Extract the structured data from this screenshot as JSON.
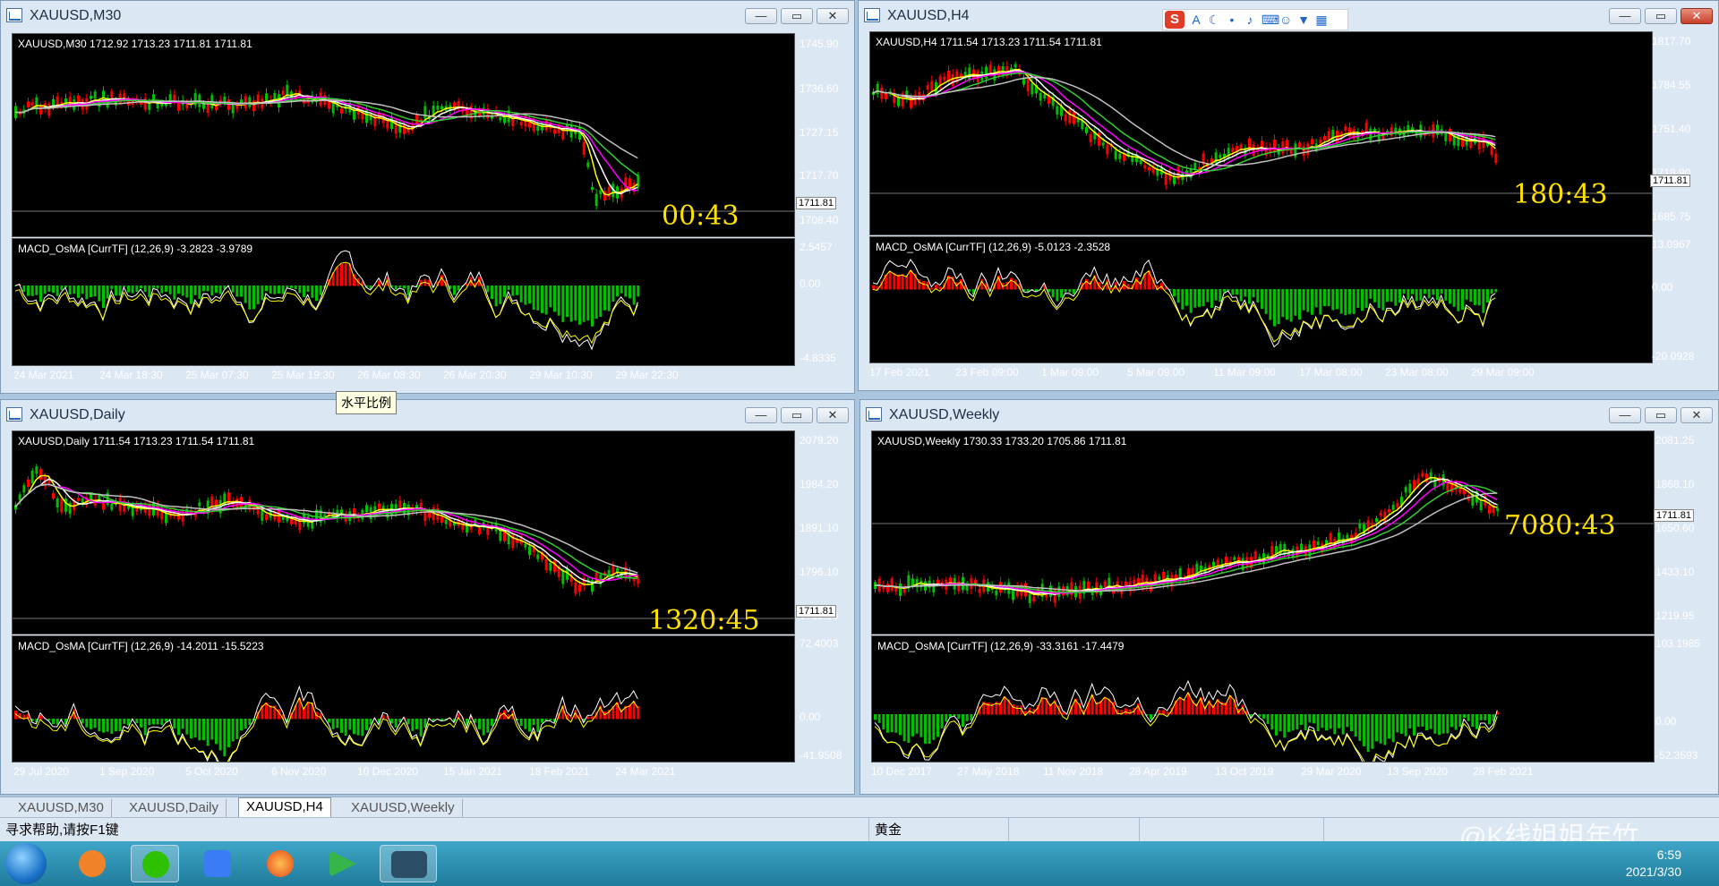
{
  "windows": [
    {
      "id": "m30",
      "title": "XAUUSD,M30",
      "info": "XAUUSD,M30  1712.92 1713.23 1711.81 1711.81",
      "price_labels": [
        "1745.90",
        "1736.60",
        "1727.15",
        "1717.70",
        "1708.40"
      ],
      "current_price": "1711.81",
      "countdown": "00:43",
      "macd_info": "MACD_OsMA [CurrTF] (12,26,9) -3.2823 -3.9789",
      "macd_labels": [
        "2.5457",
        "0.00",
        "-4.8335"
      ],
      "time_labels": [
        "24 Mar 2021",
        "24 Mar 18:30",
        "25 Mar 07:30",
        "25 Mar 19:30",
        "26 Mar 08:30",
        "26 Mar 20:30",
        "29 Mar 10:30",
        "29 Mar 22:30"
      ]
    },
    {
      "id": "h4",
      "title": "XAUUSD,H4",
      "info": "XAUUSD,H4  1711.54 1713.23 1711.54 1711.81",
      "price_labels": [
        "1817.70",
        "1784.55",
        "1751.40",
        "1718.90",
        "1685.75"
      ],
      "current_price": "1711.81",
      "countdown": "180:43",
      "macd_info": "MACD_OsMA [CurrTF] (12,26,9) -5.0123 -2.3528",
      "macd_labels": [
        "13.0967",
        "0.00",
        "-20.0928"
      ],
      "time_labels": [
        "17 Feb 2021",
        "23 Feb 09:00",
        "1 Mar 09:00",
        "5 Mar 09:00",
        "11 Mar 09:00",
        "17 Mar 08:00",
        "23 Mar 08:00",
        "29 Mar 09:00"
      ]
    },
    {
      "id": "daily",
      "title": "XAUUSD,Daily",
      "info": "XAUUSD,Daily  1711.54 1713.23 1711.54 1711.81",
      "price_labels": [
        "2079.20",
        "1984.20",
        "1891.10",
        "1796.10",
        "1703.00"
      ],
      "current_price": "1711.81",
      "countdown": "1320:45",
      "macd_info": "MACD_OsMA [CurrTF] (12,26,9) -14.2011 -15.5223",
      "macd_labels": [
        "72.4003",
        "0.00",
        "-41.9508"
      ],
      "time_labels": [
        "29 Jul 2020",
        "1 Sep 2020",
        "5 Oct 2020",
        "6 Nov 2020",
        "10 Dec 2020",
        "15 Jan 2021",
        "18 Feb 2021",
        "24 Mar 2021"
      ]
    },
    {
      "id": "weekly",
      "title": "XAUUSD,Weekly",
      "info": "XAUUSD,Weekly  1730.33 1733.20 1705.86 1711.81",
      "price_labels": [
        "2081.25",
        "1868.10",
        "1650.60",
        "1433.10",
        "1219.95"
      ],
      "current_price": "1711.81",
      "countdown": "7080:43",
      "macd_info": "MACD_OsMA [CurrTF] (12,26,9) -33.3161 -17.4479",
      "macd_labels": [
        "103.1985",
        "0.00",
        "-52.3593"
      ],
      "time_labels": [
        "10 Dec 2017",
        "27 May 2018",
        "11 Nov 2018",
        "28 Apr 2019",
        "13 Oct 2019",
        "29 Mar 2020",
        "13 Sep 2020",
        "28 Feb 2021"
      ]
    }
  ],
  "tooltip": "水平比例",
  "tabs": [
    "XAUUSD,M30",
    "XAUUSD,Daily",
    "XAUUSD,H4",
    "XAUUSD,Weekly"
  ],
  "active_tab": "XAUUSD,H4",
  "status": {
    "help": "寻求帮助,请按F1键",
    "symbol_name": "黄金"
  },
  "clock": {
    "time": "6:59",
    "date": "2021/3/30"
  },
  "watermark": "@K线姐姐年竹",
  "ime_logo": "S",
  "colors": {
    "bull": "#00c000",
    "bear": "#ff0000",
    "ma_yellow": "#ffff00",
    "ma_magenta": "#ff00ff",
    "ma_green": "#32cd32",
    "ma_silver": "#c0c0c0",
    "countdown": "#ffe000"
  }
}
